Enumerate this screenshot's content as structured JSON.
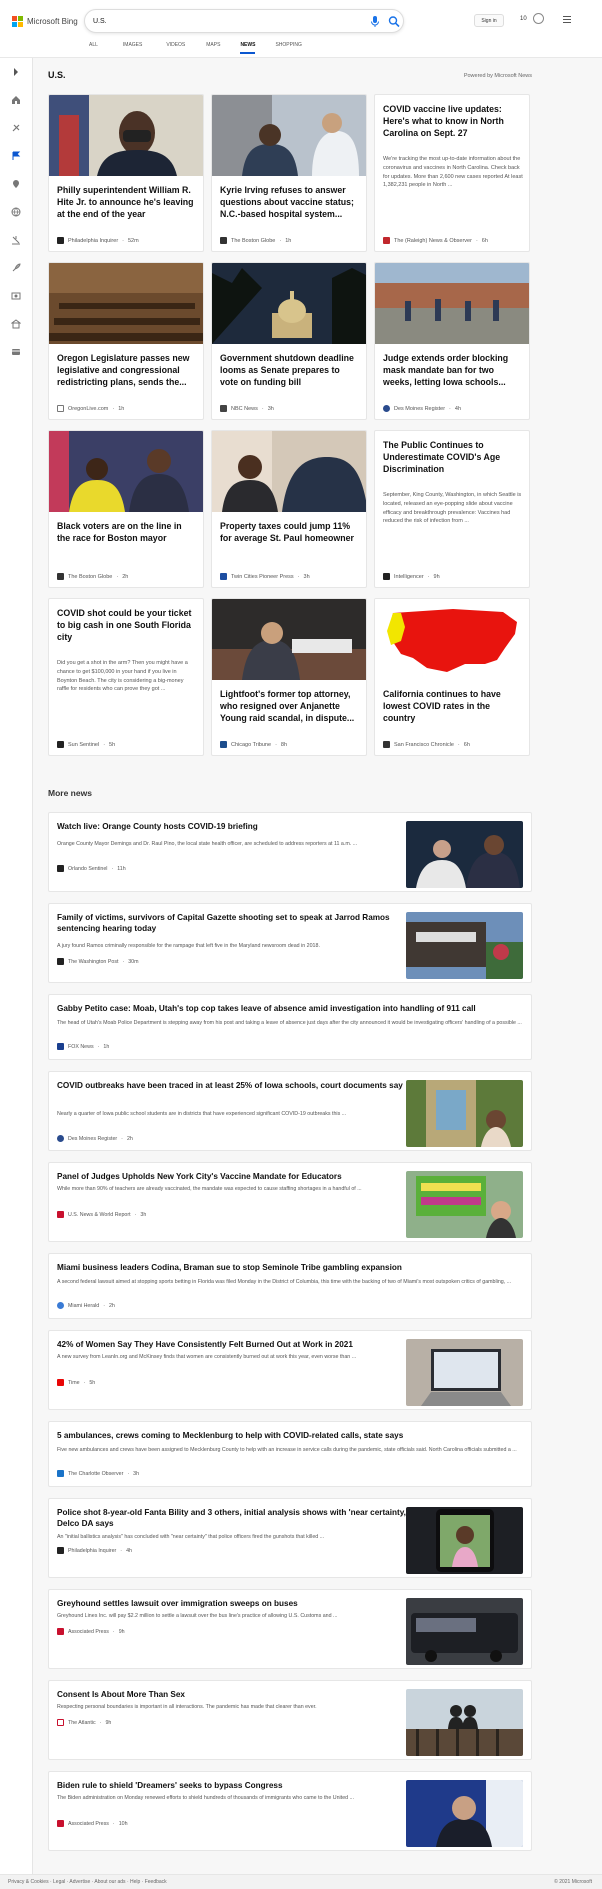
{
  "header": {
    "brand": "Microsoft Bing",
    "search_value": "U.S.",
    "signin": "Sign in",
    "points": "10",
    "tabs": [
      {
        "label": "ALL"
      },
      {
        "label": "IMAGES"
      },
      {
        "label": "VIDEOS"
      },
      {
        "label": "MAPS"
      },
      {
        "label": "NEWS"
      },
      {
        "label": "SHOPPING"
      }
    ],
    "active_tab": "NEWS",
    "logo_colors": [
      "#f25022",
      "#7fba00",
      "#00a4ef",
      "#ffb900"
    ]
  },
  "rail": {
    "icons": [
      "chevron-right-icon",
      "home-icon",
      "us-icon",
      "flag-icon",
      "location-icon",
      "globe-icon",
      "scale-icon",
      "rocket-icon",
      "film-icon",
      "health-icon",
      "card-icon"
    ]
  },
  "section": {
    "title": "U.S.",
    "powered": "Powered by Microsoft News"
  },
  "cards": [
    {
      "title": "Philly superintendent William R. Hite Jr. to announce he's leaving at the end of the year",
      "source": "Philadelphia Inquirer",
      "age": "52m"
    },
    {
      "title": "Kyrie Irving refuses to answer questions about vaccine status; N.C.-based hospital system...",
      "source": "The Boston Globe",
      "age": "1h"
    },
    {
      "title": "COVID vaccine live updates: Here's what to know in North Carolina on Sept. 27",
      "snippet": "We're tracking the most up-to-date information about the coronavirus and vaccines in North Carolina. Check back for updates. More than 2,600 new cases reported At least 1,382,231 people in North ...",
      "source": "The (Raleigh) News & Observer",
      "age": "6h"
    },
    {
      "title": "Oregon Legislature passes new legislative and congressional redistricting plans, sends the...",
      "source": "OregonLive.com",
      "age": "1h"
    },
    {
      "title": "Government shutdown deadline looms as Senate prepares to vote on funding bill",
      "source": "NBC News",
      "age": "3h"
    },
    {
      "title": "Judge extends order blocking mask mandate ban for two weeks, letting Iowa schools...",
      "source": "Des Moines Register",
      "age": "4h"
    },
    {
      "title": "Black voters are on the line in the race for Boston mayor",
      "source": "The Boston Globe",
      "age": "2h"
    },
    {
      "title": "Property taxes could jump 11% for average St. Paul homeowner",
      "source": "Twin Cities Pioneer Press",
      "age": "3h"
    },
    {
      "title": "The Public Continues to Underestimate COVID's Age Discrimination",
      "snippet": "September, King County, Washington, in which Seattle is located, released an eye-popping slide about vaccine efficacy and breakthrough prevalence: Vaccines had reduced the risk of infection from ...",
      "source": "Intelligencer",
      "age": "9h"
    },
    {
      "title": "COVID shot could be your ticket to big cash in one South Florida city",
      "snippet": "Did you get a shot in the arm? Then you might have a chance to get $100,000 in your hand if you live in Boynton Beach. The city is considering a big-money raffle for residents who can prove they got ...",
      "source": "Sun Sentinel",
      "age": "5h"
    },
    {
      "title": "Lightfoot's former top attorney, who resigned over Anjanette Young raid scandal, in dispute...",
      "source": "Chicago Tribune",
      "age": "8h"
    },
    {
      "title": "California continues to have lowest COVID rates in the country",
      "source": "San Francisco Chronicle",
      "age": "6h"
    }
  ],
  "more": {
    "title": "More news",
    "items": [
      {
        "title": "Watch live: Orange County hosts COVID-19 briefing",
        "snippet": "Orange County Mayor Demings and Dr. Raul Pino, the local state health officer, are scheduled to address reporters at 11 a.m. ...",
        "source": "Orlando Sentinel",
        "age": "11h"
      },
      {
        "title": "Family of victims, survivors of Capital Gazette shooting set to speak at Jarrod Ramos sentencing hearing today",
        "snippet": "A jury found Ramos criminally responsible for the rampage that left five in the Maryland newsroom dead in 2018.",
        "source": "The Washington Post",
        "age": "30m"
      },
      {
        "title": "Gabby Petito case: Moab, Utah's top cop takes leave of absence amid investigation into handling of 911 call",
        "snippet": "The head of Utah's Moab Police Department is stepping away from his post and taking a leave of absence just days after the city announced it would be investigating officers' handling of a possible ...",
        "source": "FOX News",
        "age": "1h"
      },
      {
        "title": "COVID outbreaks have been traced in at least 25% of Iowa schools, court documents say",
        "snippet": "Nearly a quarter of Iowa public school students are in districts that have experienced significant COVID-19 outbreaks this ...",
        "source": "Des Moines Register",
        "age": "2h"
      },
      {
        "title": "Panel of Judges Upholds New York City's Vaccine Mandate for Educators",
        "snippet": "While more than 90% of teachers are already vaccinated, the mandate was expected to cause staffing shortages in a handful of ...",
        "source": "U.S. News & World Report",
        "age": "3h"
      },
      {
        "title": "Miami business leaders Codina, Braman sue to stop Seminole Tribe gambling expansion",
        "snippet": "A second federal lawsuit aimed at stopping sports betting in Florida was filed Monday in the District of Columbia, this time with the backing of two of Miami's most outspoken critics of gambling, ...",
        "source": "Miami Herald",
        "age": "2h"
      },
      {
        "title": "42% of Women Say They Have Consistently Felt Burned Out at Work in 2021",
        "snippet": "A new survey from LeanIn.org and McKinsey finds that women are consistently burned out at work this year, even worse than ...",
        "source": "Time",
        "age": "5h"
      },
      {
        "title": "5 ambulances, crews coming to Mecklenburg to help with COVID-related calls, state says",
        "snippet": "Five new ambulances and crews have been assigned to Mecklenburg County to help with an increase in service calls during the pandemic, state officials said. North Carolina officials submitted a ...",
        "source": "The Charlotte Observer",
        "age": "3h"
      },
      {
        "title": "Police shot 8-year-old Fanta Bility and 3 others, initial analysis shows with 'near certainty,' Delco DA says",
        "snippet": "An \"initial ballistics analysis\" has concluded with \"near certainty\" that police officers fired the gunshots that killed ...",
        "source": "Philadelphia Inquirer",
        "age": "4h"
      },
      {
        "title": "Greyhound settles lawsuit over immigration sweeps on buses",
        "snippet": "Greyhound Lines Inc. will pay $2.2 million to settle a lawsuit over the bus line's practice of allowing U.S. Customs and ...",
        "source": "Associated Press",
        "age": "9h"
      },
      {
        "title": "Consent Is About More Than Sex",
        "snippet": "Respecting personal boundaries is important in all interactions. The pandemic has made that clearer than ever.",
        "source": "The Atlantic",
        "age": "9h"
      },
      {
        "title": "Biden rule to shield 'Dreamers' seeks to bypass Congress",
        "snippet": "The Biden administration on Monday renewed efforts to shield hundreds of thousands of immigrants who came to the United ...",
        "source": "Associated Press",
        "age": "10h"
      }
    ]
  },
  "footer": {
    "left": "Privacy & Cookies · Legal · Advertise · About our ads · Help · Feedback",
    "right": "© 2021 Microsoft"
  }
}
